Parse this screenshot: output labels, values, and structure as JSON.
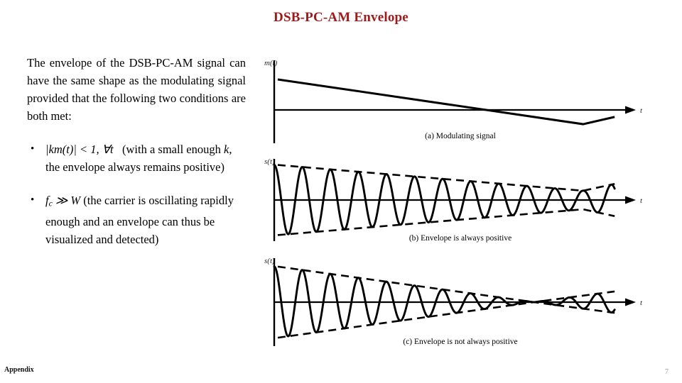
{
  "slide": {
    "title": "DSB-PC-AM Envelope",
    "title_color": "#9e1b1b",
    "footer_left": "Appendix",
    "page_number": "7"
  },
  "body_text": {
    "intro": "The envelope of the DSB-PC-AM signal can have the same shape as the modulating signal provided that the following two conditions are both met:",
    "bullets": [
      {
        "marker": "•",
        "math": "|km(t)| < 1, ∀t",
        "text": "(with a small enough",
        "math_inline": "k",
        "text_tail": ", the envelope always remains positive)"
      },
      {
        "marker": "•",
        "math": "f",
        "math_sub": "c",
        "math_op": "≫ W",
        "text": "(the carrier is oscillating rapidly enough and an envelope can thus be visualized and detected)"
      }
    ]
  },
  "chart_data": [
    {
      "id": "fig-a",
      "type": "line",
      "title": "",
      "caption": "(a) Modulating signal",
      "ylabel": "m(t)",
      "xlabel": "t",
      "grid": false,
      "axis_y_at": 0,
      "xlim": [
        0,
        100
      ],
      "ylim": [
        -1.15,
        1.15
      ],
      "series": [
        {
          "name": "modulating-signal",
          "style": "solid",
          "x": [
            1,
            88,
            97
          ],
          "values": [
            0.62,
            -0.62,
            -0.42
          ]
        }
      ]
    },
    {
      "id": "fig-b",
      "type": "line",
      "title": "",
      "caption": "(b) Envelope is always positive",
      "ylabel": "s(t)",
      "xlabel": "t",
      "grid": false,
      "axis_y_at": 0,
      "xlim": [
        0,
        100
      ],
      "ylim": [
        -1.15,
        1.15
      ],
      "carrier_cycles": 12.5,
      "envelope_offset": 1.0,
      "envelope_gain": 0.62,
      "always_positive": true,
      "series": [
        {
          "name": "upper-envelope",
          "style": "dashed",
          "x": [
            1,
            88,
            97
          ],
          "values": [
            0.98,
            0.26,
            0.45
          ]
        },
        {
          "name": "lower-envelope",
          "style": "dashed",
          "x": [
            1,
            88,
            97
          ],
          "values": [
            -0.98,
            -0.26,
            -0.45
          ]
        },
        {
          "name": "am-waveform",
          "style": "solid",
          "description": "carrier modulated by positive envelope, 12.5 cycles"
        }
      ]
    },
    {
      "id": "fig-c",
      "type": "line",
      "title": "",
      "caption": "(c) Envelope is not always positive",
      "ylabel": "s(t)",
      "xlabel": "t",
      "grid": false,
      "axis_y_at": 0,
      "xlim": [
        0,
        100
      ],
      "ylim": [
        -1.15,
        1.15
      ],
      "carrier_cycles": 12.5,
      "envelope_offset": 0.0,
      "envelope_gain": 1.0,
      "always_positive": false,
      "zero_crossing_x": 74,
      "series": [
        {
          "name": "upper-envelope",
          "style": "dashed",
          "x": [
            1,
            74,
            97
          ],
          "values": [
            0.93,
            0.0,
            -0.28
          ]
        },
        {
          "name": "lower-envelope",
          "style": "dashed",
          "x": [
            1,
            74,
            97
          ],
          "values": [
            -0.93,
            0.0,
            0.28
          ]
        },
        {
          "name": "am-waveform",
          "style": "solid",
          "description": "carrier modulated by envelope that crosses zero and inverts phase"
        }
      ]
    }
  ]
}
